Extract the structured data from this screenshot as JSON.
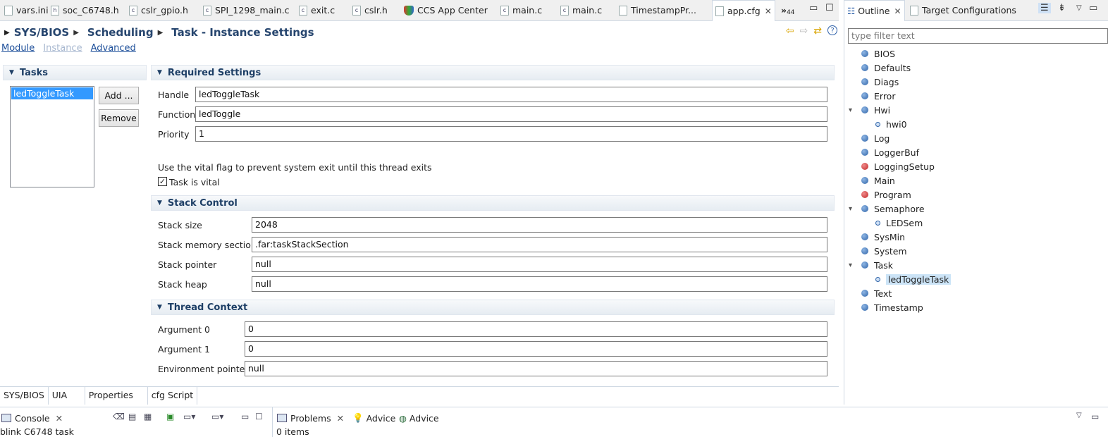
{
  "editor_tabs": [
    {
      "label": "vars.ini"
    },
    {
      "label": "soc_C6748.h"
    },
    {
      "label": "cslr_gpio.h"
    },
    {
      "label": "SPI_1298_main.c"
    },
    {
      "label": "exit.c"
    },
    {
      "label": "cslr.h"
    },
    {
      "label": "CCS App Center"
    },
    {
      "label": "main.c"
    },
    {
      "label": "main.c"
    },
    {
      "label": "TimestampPr..."
    },
    {
      "label": "app.cfg"
    }
  ],
  "overflow_count": "44",
  "breadcrumb": [
    "SYS/BIOS",
    "Scheduling",
    "Task - Instance Settings"
  ],
  "module_links": {
    "module": "Module",
    "instance": "Instance",
    "advanced": "Advanced"
  },
  "tasks": {
    "header": "Tasks",
    "items": [
      "ledToggleTask"
    ],
    "add_label": "Add ...",
    "remove_label": "Remove"
  },
  "required": {
    "header": "Required Settings",
    "handle_label": "Handle",
    "handle_value": "ledToggleTask",
    "function_label": "Function",
    "function_value": "ledToggle",
    "priority_label": "Priority",
    "priority_value": "1",
    "vital_note": "Use the vital flag to prevent system exit until this thread exits",
    "vital_label": "Task is vital",
    "vital_checked": true
  },
  "stack": {
    "header": "Stack Control",
    "size_label": "Stack size",
    "size_value": "2048",
    "section_label": "Stack memory section",
    "section_value": ".far:taskStackSection",
    "pointer_label": "Stack pointer",
    "pointer_value": "null",
    "heap_label": "Stack heap",
    "heap_value": "null"
  },
  "thread": {
    "header": "Thread Context",
    "arg0_label": "Argument 0",
    "arg0_value": "0",
    "arg1_label": "Argument 1",
    "arg1_value": "0",
    "env_label": "Environment pointer",
    "env_value": "null"
  },
  "bottom_tabs": [
    "SYS/BIOS",
    "UIA",
    "Properties",
    "cfg Script"
  ],
  "outline": {
    "tab_outline": "Outline",
    "tab_target": "Target Configurations",
    "filter_placeholder": "type filter text",
    "items": [
      {
        "label": "BIOS"
      },
      {
        "label": "Defaults"
      },
      {
        "label": "Diags"
      },
      {
        "label": "Error"
      },
      {
        "label": "Hwi"
      },
      {
        "label": "hwi0"
      },
      {
        "label": "Log"
      },
      {
        "label": "LoggerBuf"
      },
      {
        "label": "LoggingSetup"
      },
      {
        "label": "Main"
      },
      {
        "label": "Program"
      },
      {
        "label": "Semaphore"
      },
      {
        "label": "LEDSem"
      },
      {
        "label": "SysMin"
      },
      {
        "label": "System"
      },
      {
        "label": "Task"
      },
      {
        "label": "ledToggleTask"
      },
      {
        "label": "Text"
      },
      {
        "label": "Timestamp"
      }
    ]
  },
  "console": {
    "tab": "Console",
    "text": "blink C6748 task"
  },
  "problems": {
    "tab": "Problems",
    "advice1": "Advice",
    "advice2": "Advice",
    "text": "0 items"
  }
}
